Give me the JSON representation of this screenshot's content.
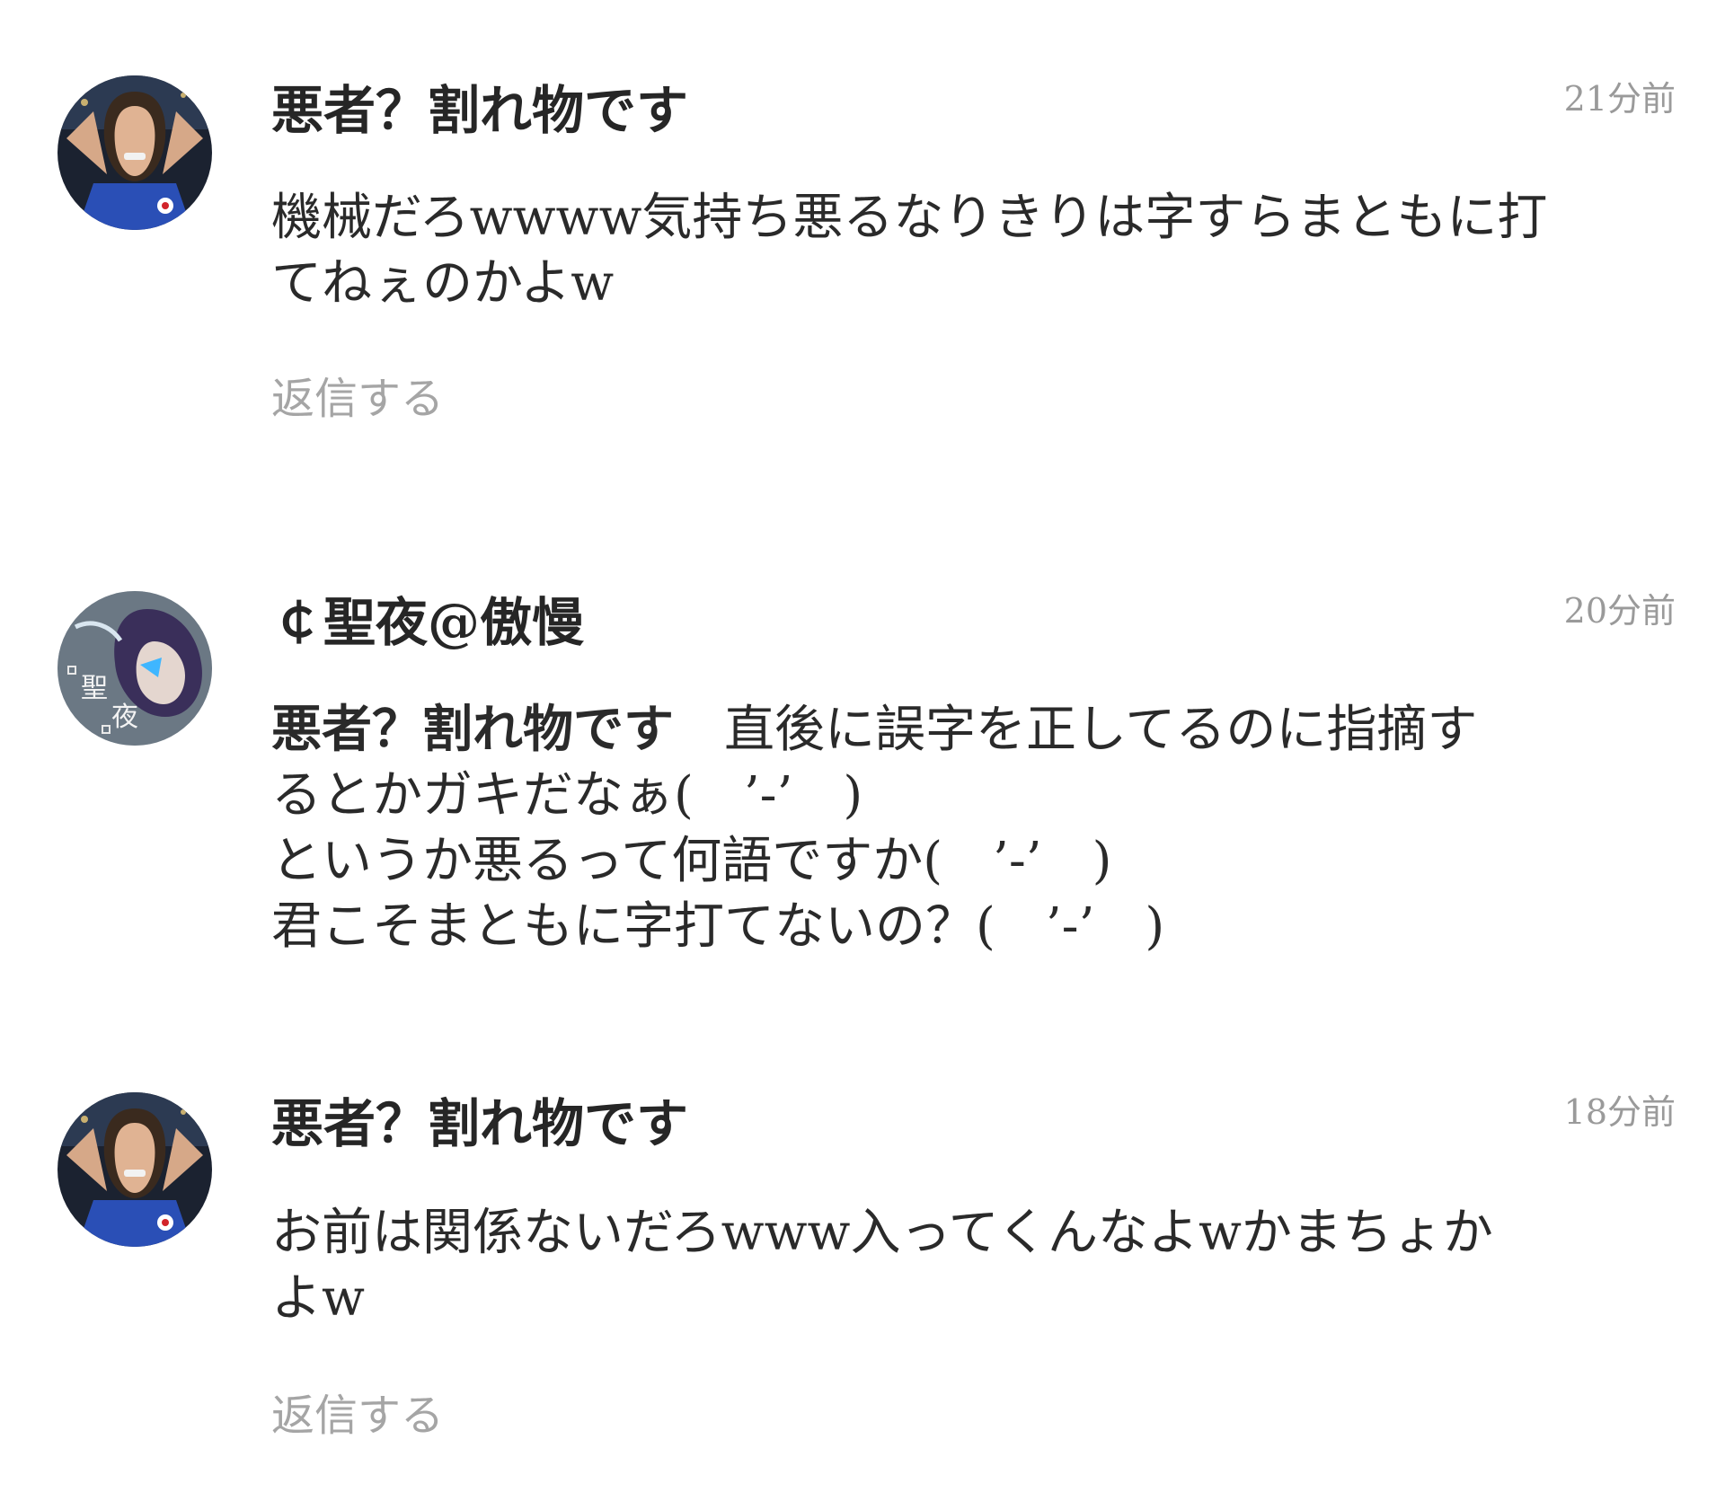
{
  "comments": [
    {
      "username": "悪者？割れ物です",
      "time": "21分前",
      "lines": [
        "機械だろwwww気持ち悪るなりきりは字すらまともに打",
        "てねぇのかよw"
      ],
      "reply_label": "返信する",
      "avatar_icon": "wrestler-photo-avatar"
    },
    {
      "username": "￠聖夜@傲慢",
      "time": "20分前",
      "mention": "悪者？割れ物です",
      "first_line_rest": "直後に誤字を正してるのに指摘す",
      "lines": [
        "るとかガキだなぁ(　’-’　)",
        "というか悪るって何語ですか(　’-’　)",
        "君こそまともに字打てないの？(　’-’　)"
      ],
      "avatar_icon": "anime-character-avatar",
      "avatar_text": [
        "聖",
        "夜"
      ]
    },
    {
      "username": "悪者？割れ物です",
      "time": "18分前",
      "lines": [
        "お前は関係ないだろwww入ってくんなよwかまちょか",
        "よw"
      ],
      "reply_label": "返信する",
      "avatar_icon": "wrestler-photo-avatar"
    }
  ],
  "colors": {
    "username": "#262626",
    "timestamp": "#9a9a9a",
    "reply": "#a5a5a5",
    "body": "#2a2a2a",
    "background": "#ffffff"
  }
}
